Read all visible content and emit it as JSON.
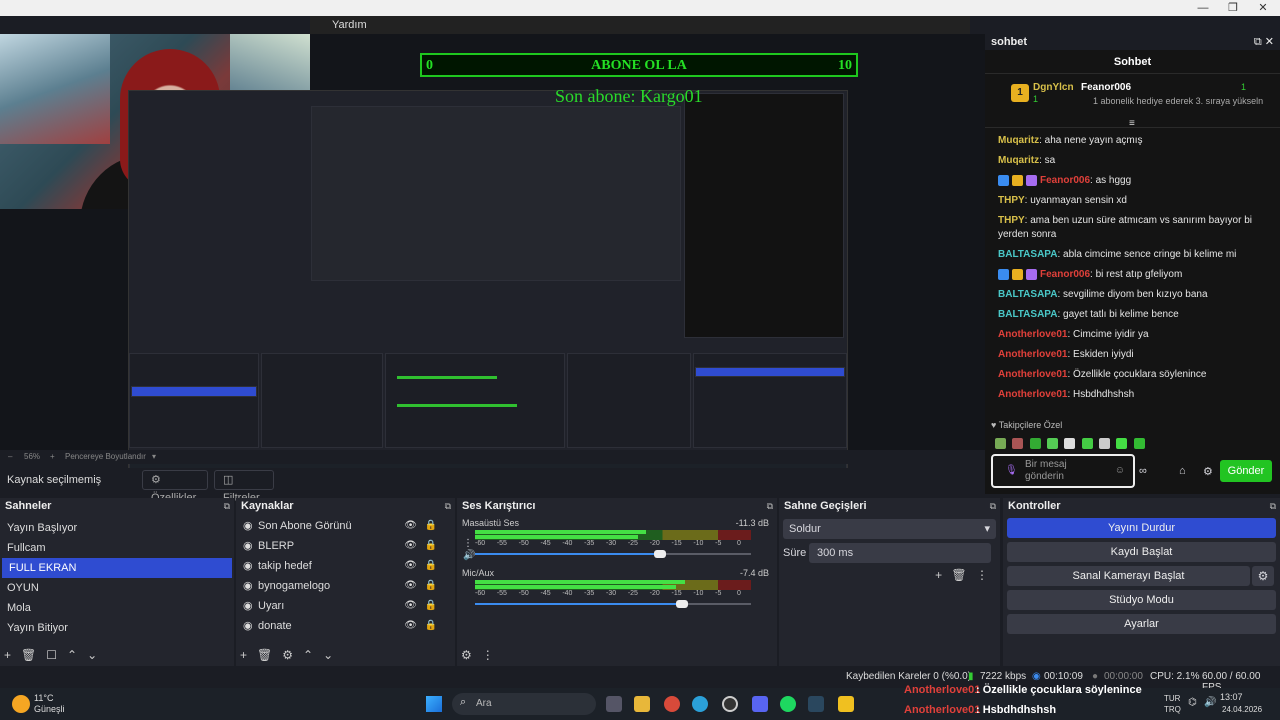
{
  "window": {
    "menu_item": "Yardım",
    "min_icon": "minimize-icon",
    "max_icon": "maximize-icon",
    "close_icon": "close-icon"
  },
  "overlay": {
    "counter_left": "0",
    "counter_title": "ABONE OL LA",
    "counter_right": "10",
    "last_sub": "Son abone: Kargo01"
  },
  "zoom": {
    "minus": "–",
    "value": "56%",
    "plus": "+",
    "fit_label": "Pencereye Boyutlandır"
  },
  "source_toolbar": {
    "no_source": "Kaynak seçilmemiş",
    "properties": "Özellikler",
    "filters": "Filtreler"
  },
  "scenes": {
    "title": "Sahneler",
    "items": [
      "Yayın Başlıyor",
      "Fullcam",
      "FULL EKRAN",
      "OYUN",
      "Mola",
      "Yayın Bitiyor"
    ],
    "selected_index": 2
  },
  "sources": {
    "title": "Kaynaklar",
    "items": [
      "Son Abone Görünü",
      "BLERP",
      "takip hedef",
      "bynogamelogo",
      "Uyarı",
      "donate"
    ]
  },
  "mixer": {
    "title": "Ses Karıştırıcı",
    "channels": [
      {
        "name": "Masaüstü Ses",
        "db": "-11.3 dB",
        "level": 0.62,
        "volume": 0.67
      },
      {
        "name": "Mic/Aux",
        "db": "-7.4 dB",
        "level": 0.76,
        "volume": 0.75
      }
    ],
    "ticks": [
      "-60",
      "-55",
      "-50",
      "-45",
      "-40",
      "-35",
      "-30",
      "-25",
      "-20",
      "-15",
      "-10",
      "-5",
      "0"
    ]
  },
  "transitions": {
    "title": "Sahne Geçişleri",
    "selected": "Soldur",
    "duration_label": "Süre",
    "duration_value": "300 ms"
  },
  "controls": {
    "title": "Kontroller",
    "buttons": [
      "Yayını Durdur",
      "Kaydı Başlat",
      "Sanal Kamerayı Başlat",
      "Stüdyo Modu",
      "Ayarlar"
    ]
  },
  "chat": {
    "dock_title": "sohbet",
    "title": "Sohbet",
    "pinned_user": "DgnYlcn",
    "pinned_count": "1",
    "pinned_target": "Feanor006",
    "pinned_target_count": "1",
    "pinned_text": "1 abonelik hediye ederek 3. sıraya yükseln",
    "messages": [
      {
        "user": "Muqaritz",
        "text": ": aha nene yayın açmış",
        "color": "yellow",
        "badges": false
      },
      {
        "user": "Muqaritz",
        "text": ": sa",
        "color": "yellow",
        "badges": false
      },
      {
        "user": "Feanor006",
        "text": ": as hggg",
        "color": "red",
        "badges": true
      },
      {
        "user": "THPY",
        "text": ": uyanmayan sensin xd",
        "color": "yellow",
        "badges": false
      },
      {
        "user": "THPY",
        "text": ": ama ben uzun süre atmıcam vs sanırım bayıyor bi yerden sonra",
        "color": "yellow",
        "badges": false
      },
      {
        "user": "BALTASAPA",
        "text": ": abla cimcime sence cringe bi kelime mi",
        "color": "cyan",
        "badges": false
      },
      {
        "user": "Feanor006",
        "text": ": bi rest atıp gfeliyom",
        "color": "red",
        "badges": true
      },
      {
        "user": "BALTASAPA",
        "text": ": sevgilime diyom ben kızıyo bana",
        "color": "cyan",
        "badges": false
      },
      {
        "user": "BALTASAPA",
        "text": ": gayet tatlı bi kelime bence",
        "color": "cyan",
        "badges": false
      },
      {
        "user": "Anotherlove01",
        "text": ": Cimcime iyidir ya",
        "color": "red",
        "badges": false
      },
      {
        "user": "Anotherlove01",
        "text": ": Eskiden iyiydi",
        "color": "red",
        "badges": false
      },
      {
        "user": "Anotherlove01",
        "text": ": Özellikle çocuklara söylenince",
        "color": "red",
        "badges": false
      },
      {
        "user": "Anotherlove01",
        "text": ": Hsbdhdhshsh",
        "color": "red",
        "badges": false
      }
    ],
    "followers_special": "Takipçilere Özel",
    "input_placeholder": "Bir mesaj gönderin",
    "send_label": "Gönder"
  },
  "status": {
    "dropped": "Kaybedilen Kareler 0 (%0.0)",
    "kbps": "7222 kbps",
    "live_time": "00:10:09",
    "rec_time": "00:00:00",
    "cpu": "CPU: 2.1%",
    "fps": "60.00 / 60.00 FPS"
  },
  "taskbar": {
    "weather_temp": "11°C",
    "weather_desc": "Güneşli",
    "search_placeholder": "Ara",
    "ticker_line1_user": "Anotherlove01",
    "ticker_line1_text": ": Özellikle çocuklara söylenince",
    "ticker_line2_user": "Anotherlove01",
    "ticker_line2_text": ": Hsbdhdhshsh",
    "lang": "TUR",
    "lang2": "TRQ",
    "time": "13:07",
    "date": "24.04.2026"
  },
  "colors": {
    "accent": "#2f4cd1",
    "overlay_green": "#24e024",
    "send_green": "#22c422",
    "user_yellow": "#d8c04a",
    "user_cyan": "#4ac8c8",
    "user_red": "#e0403a"
  }
}
